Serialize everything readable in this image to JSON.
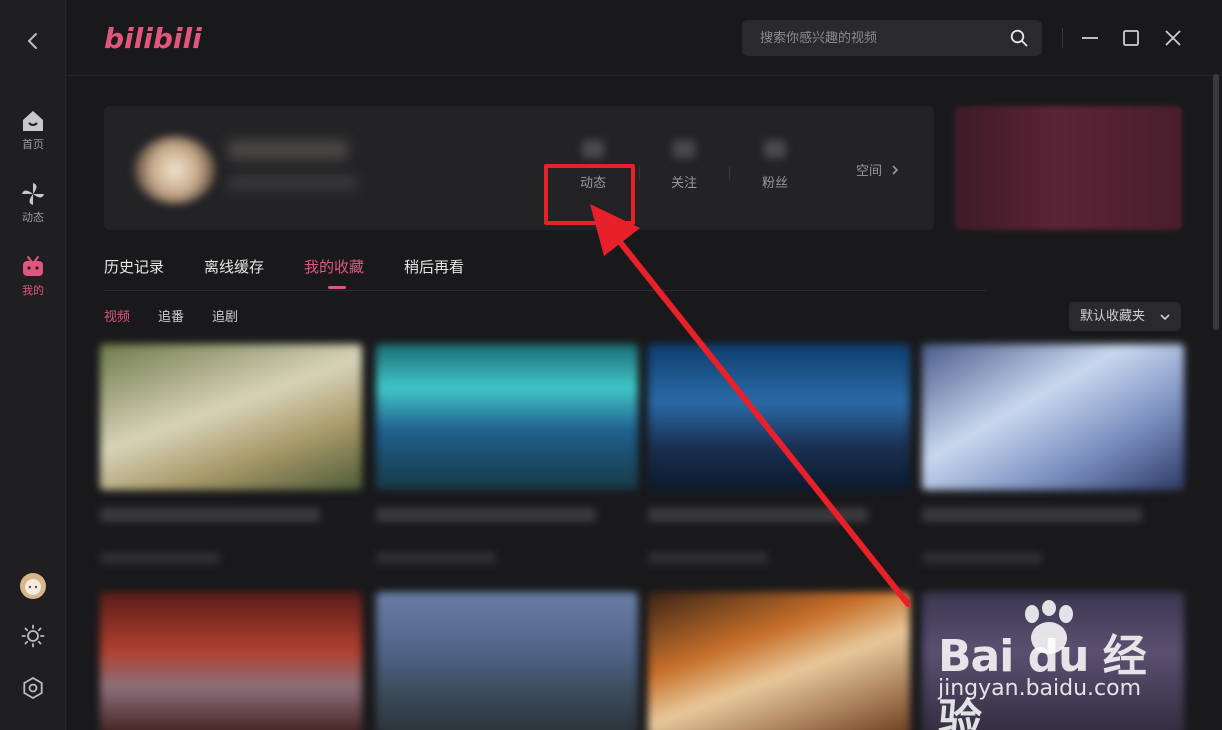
{
  "app": {
    "logo_text": "bilibili",
    "accent_color": "#e0567e"
  },
  "search": {
    "placeholder": "搜索你感兴趣的视频",
    "icon": "search-icon"
  },
  "window_controls": [
    "minimize-icon",
    "maximize-icon",
    "close-icon"
  ],
  "sidebar": {
    "back_icon": "chevron-left-icon",
    "items": [
      {
        "label": "首页",
        "icon": "home-icon",
        "active": false
      },
      {
        "label": "动态",
        "icon": "pinwheel-icon",
        "active": false
      },
      {
        "label": "我的",
        "icon": "tv-icon",
        "active": true
      }
    ],
    "bottom": [
      "avatar",
      "sun-icon",
      "settings-icon"
    ]
  },
  "profile": {
    "stats": [
      {
        "label": "动态"
      },
      {
        "label": "关注"
      },
      {
        "label": "粉丝"
      }
    ],
    "space_link": "空间"
  },
  "tabs": [
    {
      "label": "历史记录",
      "active": false
    },
    {
      "label": "离线缓存",
      "active": false
    },
    {
      "label": "我的收藏",
      "active": true
    },
    {
      "label": "稍后再看",
      "active": false
    }
  ],
  "subtabs": [
    {
      "label": "视频",
      "active": true
    },
    {
      "label": "追番",
      "active": false
    },
    {
      "label": "追剧",
      "active": false
    }
  ],
  "folder_dropdown": {
    "selected": "默认收藏夹"
  },
  "annotation": {
    "highlight_color": "#e8202a"
  },
  "watermark": {
    "line1": "Bai du 经验",
    "line2": "jingyan.baidu.com"
  }
}
